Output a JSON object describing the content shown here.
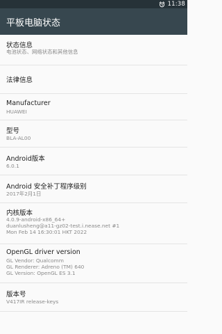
{
  "status_bar": {
    "time": "11:38",
    "alarm_icon": "alarm-clock-icon"
  },
  "app_bar": {
    "title": "平板电脑状态"
  },
  "items": [
    {
      "title": "状态信息",
      "lines": [
        "电池状态、网络状态和其他信息"
      ]
    },
    {
      "title": "法律信息",
      "lines": []
    },
    {
      "title": "Manufacturer",
      "lines": [
        "HUAWEI"
      ]
    },
    {
      "title": "型号",
      "lines": [
        "BLA-AL00"
      ]
    },
    {
      "title": "Android版本",
      "lines": [
        "6.0.1"
      ]
    },
    {
      "title": "Android 安全补丁程序级别",
      "lines": [
        "2017年2月1日"
      ]
    },
    {
      "title": "内核版本",
      "lines": [
        "4.0.9-android-x86_64+",
        "duanlusheng@a11-gz02-test.i.nease.net #1",
        "Mon Feb 14 16:30:01 HKT 2022"
      ]
    },
    {
      "title": "OpenGL driver version",
      "lines": [
        "GL Vendor: Qualcomm",
        "GL Renderer: Adreno (TM) 640",
        "GL Version: OpenGL ES 3.1"
      ]
    },
    {
      "title": "版本号",
      "lines": [
        "V417IR release-keys"
      ]
    }
  ]
}
